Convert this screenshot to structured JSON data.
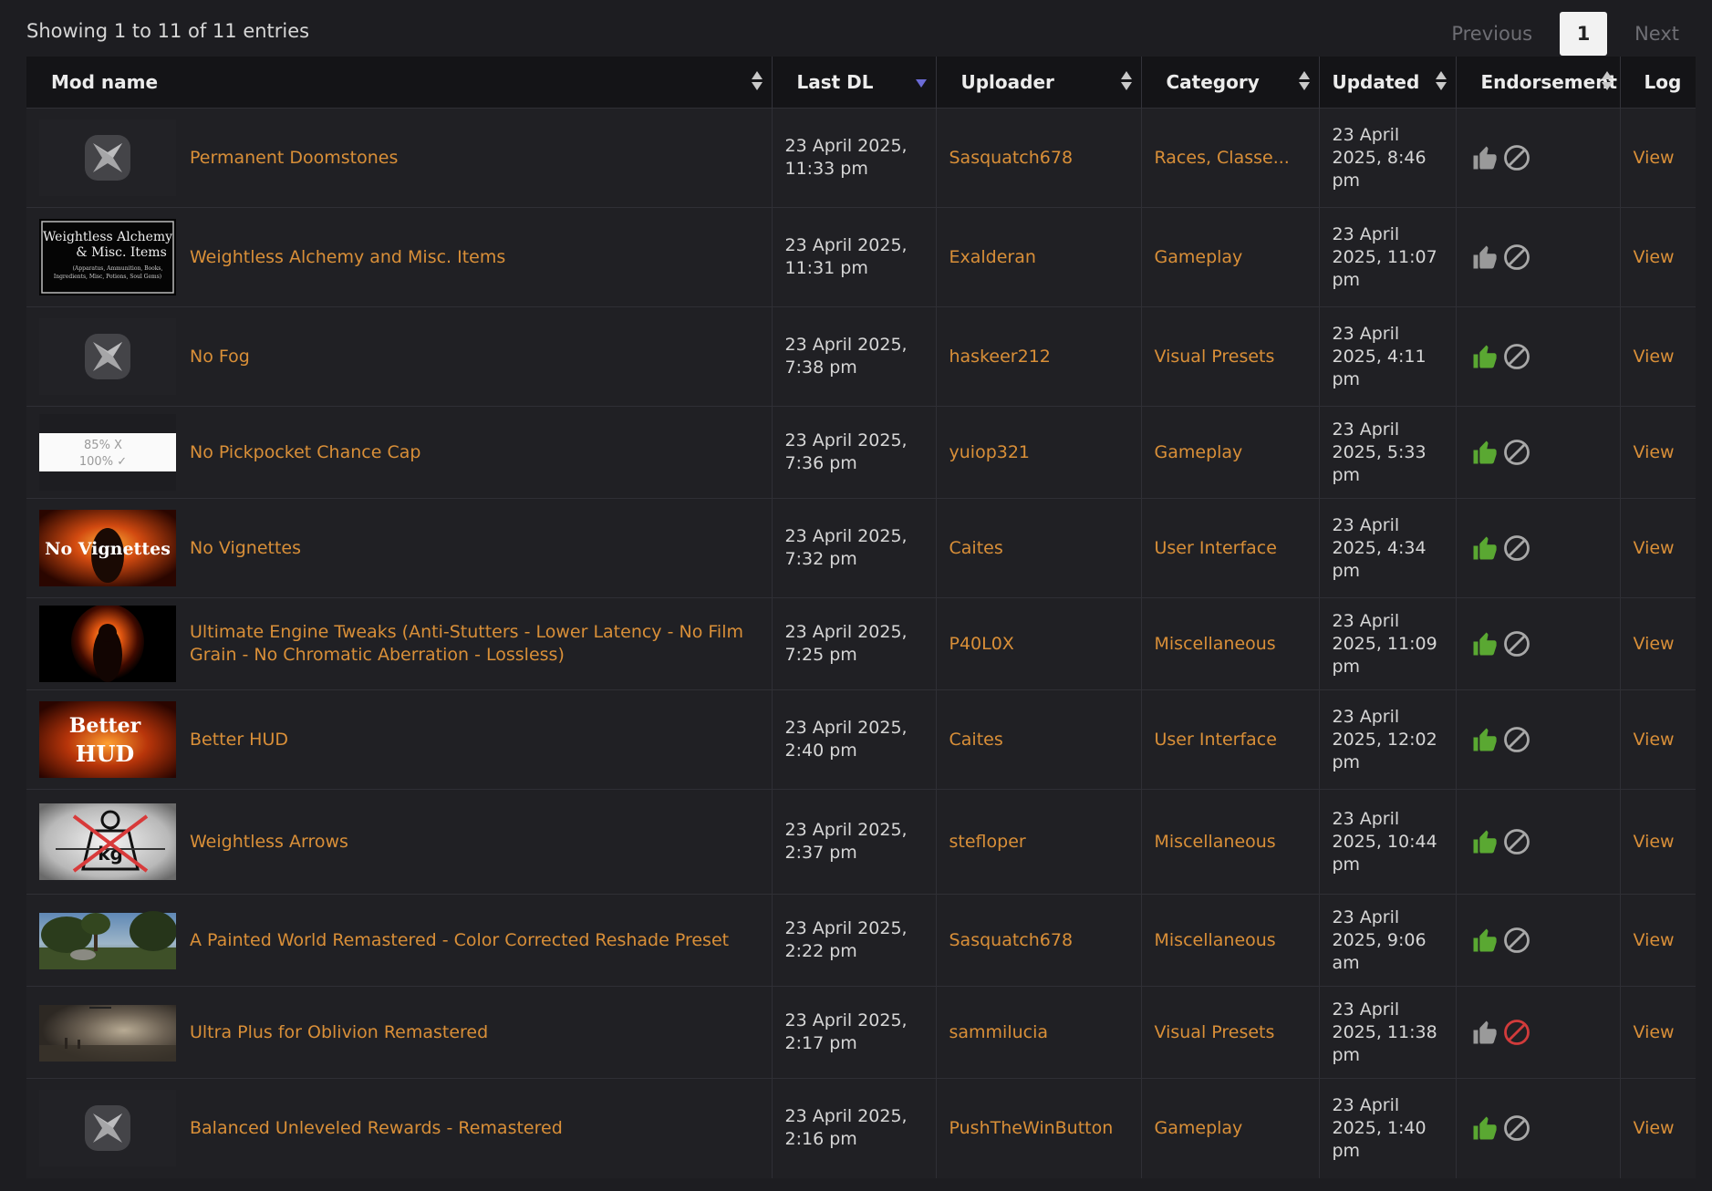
{
  "info_text": "Showing 1 to 11 of 11 entries",
  "pagination": {
    "previous": "Previous",
    "current": "1",
    "next": "Next"
  },
  "columns": [
    "Mod name",
    "Last DL",
    "Uploader",
    "Category",
    "Updated",
    "Endorsement",
    "Log"
  ],
  "colors": {
    "link": "#d98f38",
    "endorsed": "#5aa832",
    "neutral": "#9a9a9a",
    "abstained": "#d23b3b"
  },
  "rows": [
    {
      "thumb": "placeholder",
      "name": "Permanent Doomstones",
      "last_dl": "23 April 2025, 11:33 pm",
      "uploader": "Sasquatch678",
      "category": "Races, Classe...",
      "updated": "23 April 2025, 8:46 pm",
      "endorse": "neutral",
      "abstain": "neutral",
      "log": "View"
    },
    {
      "thumb": "alchemy",
      "name": "Weightless Alchemy and Misc. Items",
      "last_dl": "23 April 2025, 11:31 pm",
      "uploader": "Exalderan",
      "category": "Gameplay",
      "updated": "23 April 2025, 11:07 pm",
      "endorse": "neutral",
      "abstain": "neutral",
      "log": "View",
      "thumb_text": {
        "line1": "Weightless Alchemy",
        "line2": "& Misc. Items",
        "line3": "(Apparatus, Ammunition, Books,",
        "line4": "Ingredients, Misc, Potions, Soul Gems)"
      }
    },
    {
      "thumb": "placeholder",
      "name": "No Fog",
      "last_dl": "23 April 2025, 7:38 pm",
      "uploader": "haskeer212",
      "category": "Visual Presets",
      "updated": "23 April 2025, 4:11 pm",
      "endorse": "endorsed",
      "abstain": "neutral",
      "log": "View"
    },
    {
      "thumb": "pickpocket",
      "name": "No Pickpocket Chance Cap",
      "last_dl": "23 April 2025, 7:36 pm",
      "uploader": "yuiop321",
      "category": "Gameplay",
      "updated": "23 April 2025, 5:33 pm",
      "endorse": "endorsed",
      "abstain": "neutral",
      "log": "View",
      "thumb_text": {
        "line1": "85% X",
        "line2": "100% ✓"
      }
    },
    {
      "thumb": "vignettes",
      "name": "No Vignettes",
      "last_dl": "23 April 2025, 7:32 pm",
      "uploader": "Caites",
      "category": "User Interface",
      "updated": "23 April 2025, 4:34 pm",
      "endorse": "endorsed",
      "abstain": "neutral",
      "log": "View",
      "thumb_text": {
        "line1": "No Vignettes"
      }
    },
    {
      "thumb": "fire",
      "name": "Ultimate Engine Tweaks (Anti-Stutters - Lower Latency - No Film Grain - No Chromatic Aberration - Lossless)",
      "last_dl": "23 April 2025, 7:25 pm",
      "uploader": "P40L0X",
      "category": "Miscellaneous",
      "updated": "23 April 2025, 11:09 pm",
      "endorse": "endorsed",
      "abstain": "neutral",
      "log": "View"
    },
    {
      "thumb": "hud",
      "name": "Better HUD",
      "last_dl": "23 April 2025, 2:40 pm",
      "uploader": "Caites",
      "category": "User Interface",
      "updated": "23 April 2025, 12:02 pm",
      "endorse": "endorsed",
      "abstain": "neutral",
      "log": "View",
      "thumb_text": {
        "line1": "Better",
        "line2": "HUD"
      }
    },
    {
      "thumb": "kg",
      "name": "Weightless Arrows",
      "last_dl": "23 April 2025, 2:37 pm",
      "uploader": "stefloper",
      "category": "Miscellaneous",
      "updated": "23 April 2025, 10:44 pm",
      "endorse": "endorsed",
      "abstain": "neutral",
      "log": "View",
      "thumb_text": {
        "line1": "kg"
      }
    },
    {
      "thumb": "landscape",
      "name": "A Painted World Remastered - Color Corrected Reshade Preset",
      "last_dl": "23 April 2025, 2:22 pm",
      "uploader": "Sasquatch678",
      "category": "Miscellaneous",
      "updated": "23 April 2025, 9:06 am",
      "endorse": "endorsed",
      "abstain": "neutral",
      "log": "View"
    },
    {
      "thumb": "fog",
      "name": "Ultra Plus for Oblivion Remastered",
      "last_dl": "23 April 2025, 2:17 pm",
      "uploader": "sammilucia",
      "category": "Visual Presets",
      "updated": "23 April 2025, 11:38 pm",
      "endorse": "neutral",
      "abstain": "abstained",
      "log": "View"
    },
    {
      "thumb": "placeholder",
      "name": "Balanced Unleveled Rewards - Remastered",
      "last_dl": "23 April 2025, 2:16 pm",
      "uploader": "PushTheWinButton",
      "category": "Gameplay",
      "updated": "23 April 2025, 1:40 pm",
      "endorse": "endorsed",
      "abstain": "neutral",
      "log": "View"
    }
  ]
}
